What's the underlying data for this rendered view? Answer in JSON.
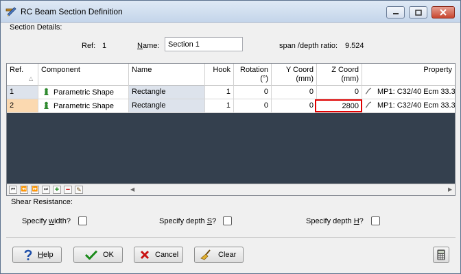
{
  "window": {
    "title": "RC Beam Section Definition"
  },
  "section_details": {
    "label": "Section Details:",
    "ref_label": "Ref:",
    "ref_value": "1",
    "name_label": "Name:",
    "name_value": "Section 1",
    "span_label": "span /depth ratio:",
    "span_value": "9.524"
  },
  "grid": {
    "columns": [
      {
        "label1": "Ref.",
        "label2": ""
      },
      {
        "label1": "Component",
        "label2": ""
      },
      {
        "label1": "Name",
        "label2": ""
      },
      {
        "label1": "Hook",
        "label2": ""
      },
      {
        "label1": "Rotation",
        "label2": "(°)"
      },
      {
        "label1": "Y Coord",
        "label2": "(mm)"
      },
      {
        "label1": "Z Coord",
        "label2": "(mm)"
      },
      {
        "label1": "Property",
        "label2": ""
      }
    ],
    "rows": [
      {
        "ref": "1",
        "component": "Parametric Shape",
        "name": "Rectangle",
        "hook": "1",
        "rotation": "0",
        "y": "0",
        "z": "0",
        "property": "MP1: C32/40 Ecm 33.3"
      },
      {
        "ref": "2",
        "component": "Parametric Shape",
        "name": "Rectangle",
        "hook": "1",
        "rotation": "0",
        "y": "0",
        "z": "2800",
        "property": "MP1: C32/40 Ecm 33.3"
      }
    ],
    "nav_icons": [
      "first-icon",
      "prev-icon",
      "next-icon",
      "last-icon",
      "add-icon",
      "remove-icon",
      "edit-icon"
    ]
  },
  "shear": {
    "label": "Shear Resistance:",
    "width_label_pre": "Specify ",
    "width_label_u": "w",
    "width_label_post": "idth?",
    "depth_s_pre": "Specify depth ",
    "depth_s_u": "S",
    "depth_s_post": "?",
    "depth_h_pre": "Specify depth ",
    "depth_h_u": "H",
    "depth_h_post": "?"
  },
  "buttons": {
    "help_u": "H",
    "help_rest": "elp",
    "ok": "OK",
    "cancel": "Cancel",
    "clear": "Clear"
  },
  "colors": {
    "accent_red": "#e00000",
    "grid_bg": "#34404e",
    "selected_ref": "#fbd9b0"
  }
}
